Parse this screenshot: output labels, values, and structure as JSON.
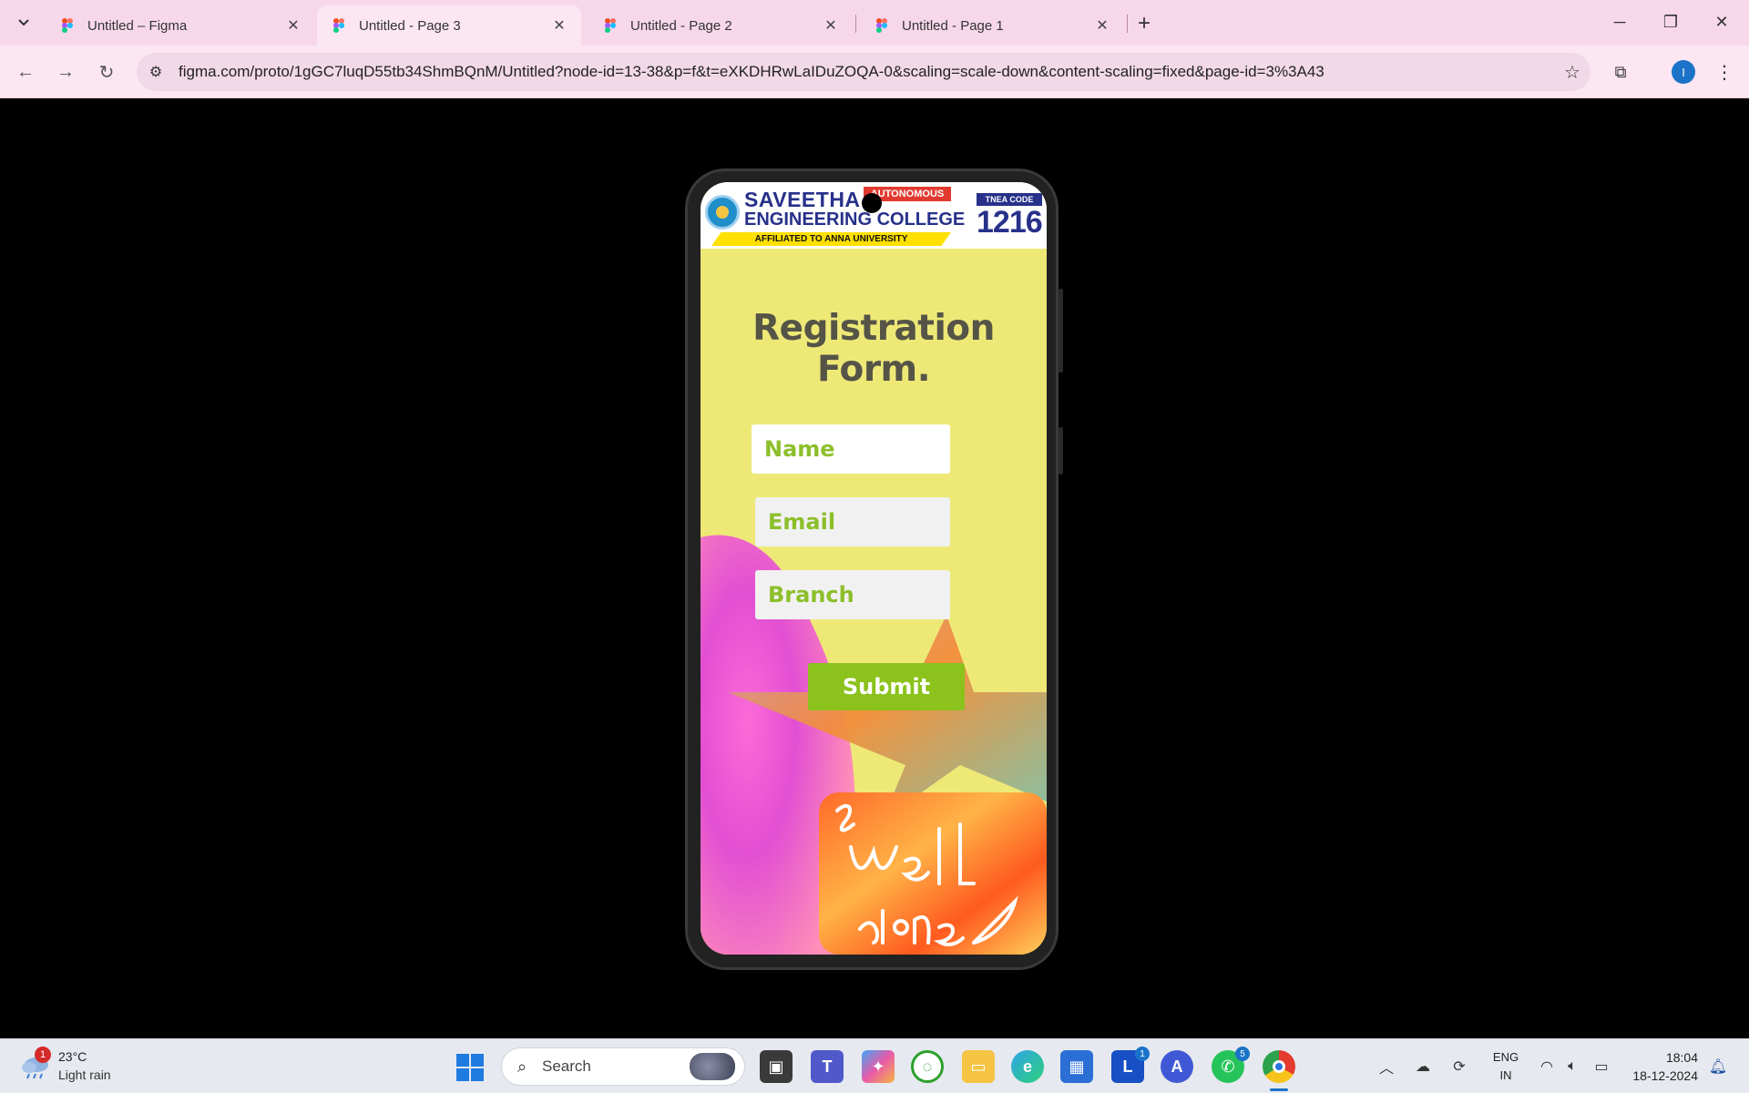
{
  "browser": {
    "tabs": [
      {
        "title": "Untitled – Figma",
        "active": false
      },
      {
        "title": "Untitled - Page 3",
        "active": true
      },
      {
        "title": "Untitled - Page 2",
        "active": false
      },
      {
        "title": "Untitled - Page 1",
        "active": false
      }
    ],
    "url": "figma.com/proto/1gGC7luqD55tb34ShmBQnM/Untitled?node-id=13-38&p=f&t=eXKDHRwLaIDuZOQA-0&scaling=scale-down&content-scaling=fixed&page-id=3%3A43",
    "profile_initial": "I"
  },
  "prototype": {
    "header": {
      "college_line1": "SAVEETHA",
      "college_line2": "ENGINEERING COLLEGE",
      "autonomous_tag": "AUTONOMOUS",
      "affiliation": "AFFILIATED TO ANNA UNIVERSITY",
      "tnea_label": "TNEA CODE",
      "tnea_code": "1216"
    },
    "form": {
      "title": "Registration Form.",
      "name_placeholder": "Name",
      "email_placeholder": "Email",
      "branch_placeholder": "Branch",
      "submit_label": "Submit"
    },
    "colors": {
      "background": "#eee977",
      "field_text": "#8cbf2a",
      "submit_bg": "#8bc21c",
      "brand_blue": "#27318a"
    }
  },
  "taskbar": {
    "weather": {
      "temp": "23°C",
      "desc": "Light rain",
      "badge": "1"
    },
    "search_label": "Search",
    "apps": [
      {
        "name": "task-view",
        "badge": ""
      },
      {
        "name": "teams",
        "badge": ""
      },
      {
        "name": "copilot",
        "badge": ""
      },
      {
        "name": "app-green",
        "badge": ""
      },
      {
        "name": "file-explorer",
        "badge": ""
      },
      {
        "name": "edge",
        "badge": ""
      },
      {
        "name": "store",
        "badge": ""
      },
      {
        "name": "app-l",
        "badge": "1"
      },
      {
        "name": "app-a",
        "badge": ""
      },
      {
        "name": "whatsapp",
        "badge": "5"
      },
      {
        "name": "chrome",
        "badge": ""
      }
    ],
    "language": {
      "line1": "ENG",
      "line2": "IN"
    },
    "clock": {
      "time": "18:04",
      "date": "18-12-2024"
    }
  }
}
